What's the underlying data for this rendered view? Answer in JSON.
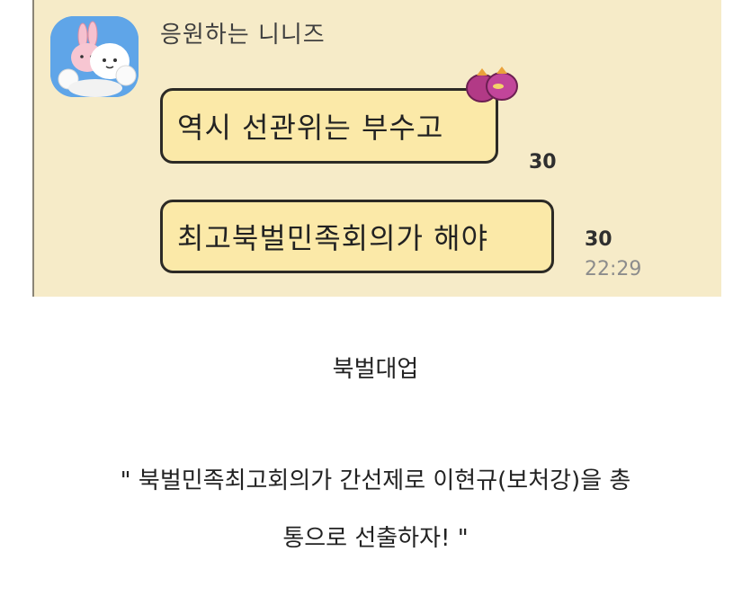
{
  "chat": {
    "sender_name": "응원하는 니니즈",
    "messages": [
      {
        "text": "역시 선관위는 부수고",
        "unread_count": "30"
      },
      {
        "text": "최고북벌민족회의가 해야",
        "unread_count": "30",
        "time": "22:29"
      }
    ]
  },
  "caption": {
    "title": "북벌대업",
    "line_1": "\" 북벌민족최고회의가 간선제로 이현규(보처강)을 총",
    "line_2": "통으로 선출하자! \""
  },
  "colors": {
    "chat_background": "#f6ebc8",
    "bubble_fill": "#fbe9a8",
    "bubble_border": "#2c2a25",
    "avatar_background": "#5fa5e8",
    "timestamp": "#8c8c8c"
  },
  "icons": {
    "avatar": "bunny-and-cloud-character-avatar-icon",
    "sticker": "sweet-potato-sticker-icon"
  }
}
